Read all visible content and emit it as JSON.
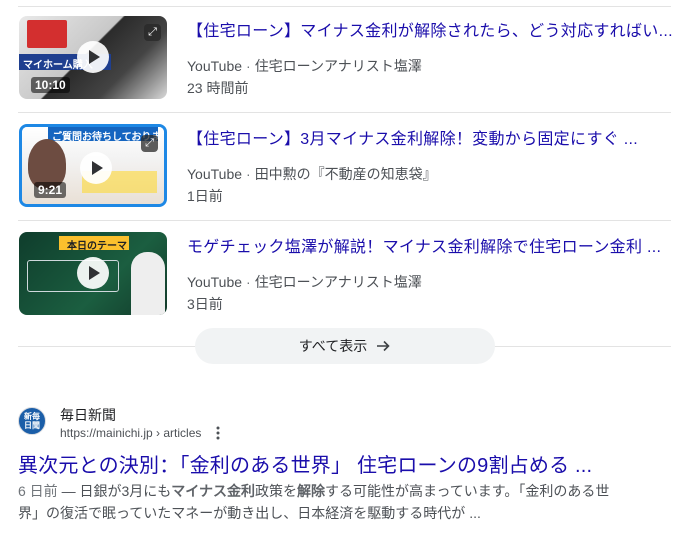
{
  "videos": [
    {
      "title": "【住宅ローン】マイナス金利が解除されたら、どう対応すればい...",
      "platform": "YouTube",
      "channel": "住宅ローンアナリスト塩澤",
      "time": "23 時間前",
      "duration": "10:10",
      "thumb_caption": "マイホーム購入"
    },
    {
      "title": "【住宅ローン】3月マイナス金利解除！変動から固定にすぐ ...",
      "platform": "YouTube",
      "channel": "田中勲の『不動産の知恵袋』",
      "time": "1日前",
      "duration": "9:21",
      "thumb_caption": "ご質問お待ちしております"
    },
    {
      "title": "モゲチェック塩澤が解説！マイナス金利解除で住宅ローン金利 ...",
      "platform": "YouTube",
      "channel": "住宅ローンアナリスト塩澤",
      "time": "3日前",
      "duration": "",
      "thumb_caption": "本日のテーマ"
    }
  ],
  "show_all": {
    "label": "すべて表示"
  },
  "result": {
    "logo_text": "新毎日聞",
    "site_name": "毎日新聞",
    "url": "https://mainichi.jp › articles",
    "title": "異次元との決別：「金利のある世界」 住宅ローンの9割占める ...",
    "age": "6 日前",
    "snippet_1": " — 日銀が3月にも",
    "snippet_bold_1": "マイナス金利",
    "snippet_2": "政策を",
    "snippet_bold_2": "解除",
    "snippet_3": "する可能性が高まっています。「金利のある世界」の復活で眠っていたマネーが動き出し、日本経済を駆動する時代が ..."
  },
  "colors": {
    "link": "#1a0dab",
    "meta": "#4d5156",
    "divider": "#e3e3e3",
    "button_bg": "#f1f3f4"
  }
}
